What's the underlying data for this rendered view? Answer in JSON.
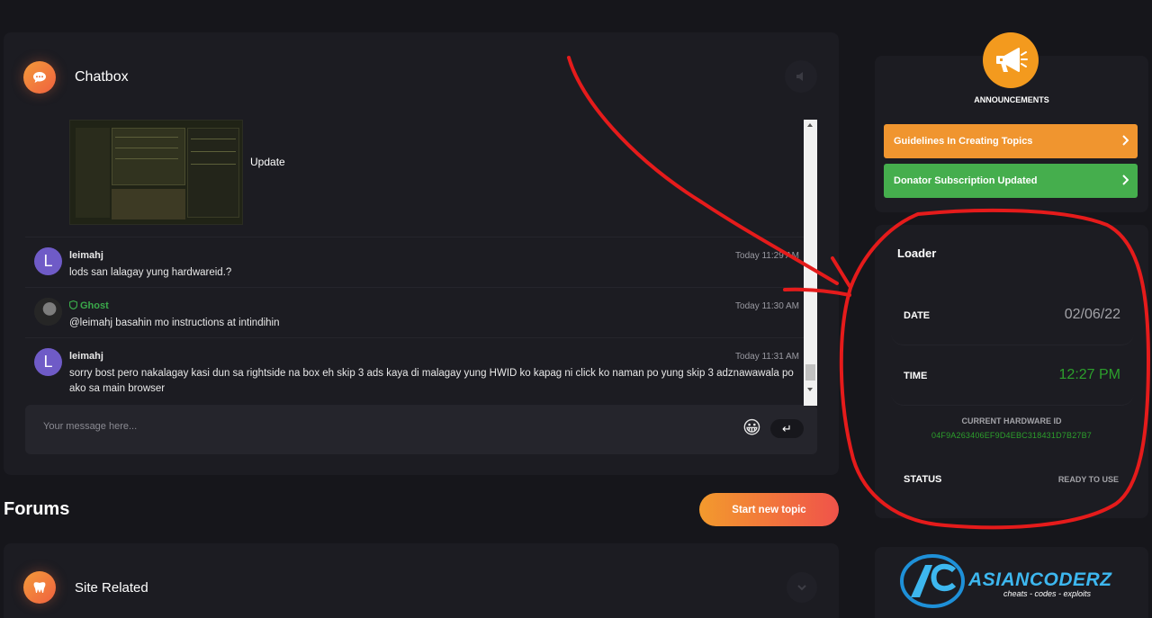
{
  "chatbox": {
    "title": "Chatbox",
    "image_caption": "Update",
    "messages": [
      {
        "avatar_letter": "L",
        "user": "leimahj",
        "time": "Today 11:29 AM",
        "text": "lods san lalagay yung hardwareid.?"
      },
      {
        "avatar_letter": "",
        "user": "Ghost",
        "time": "Today 11:30 AM",
        "text": "@leimahj basahin mo instructions at intindihin"
      },
      {
        "avatar_letter": "L",
        "user": "leimahj",
        "time": "Today 11:31 AM",
        "text": "sorry bost pero nakalagay kasi dun sa rightside na box eh skip 3 ads kaya di malagay yung HWID ko kapag ni click ko naman po yung skip 3 adznawawala po ako sa main browser"
      }
    ],
    "input_placeholder": "Your message here...",
    "emoji": "😀",
    "send_glyph": "↵"
  },
  "forums": {
    "title": "Forums",
    "new_topic_label": "Start new topic",
    "categories": [
      {
        "title": "Site Related"
      }
    ]
  },
  "announcements": {
    "label": "ANNOUNCEMENTS",
    "items": [
      {
        "label": "Guidelines In Creating Topics",
        "color": "#f0952f"
      },
      {
        "label": "Donator Subscription Updated",
        "color": "#45ae4d"
      }
    ]
  },
  "loader": {
    "title": "Loader",
    "date_label": "DATE",
    "date_value": "02/06/22",
    "time_label": "TIME",
    "time_value": "12:27 PM",
    "hwid_label": "CURRENT HARDWARE ID",
    "hwid_value": "04F9A263406EF9D4EBC318431D7B27B7",
    "status_label": "STATUS",
    "status_value": "READY TO USE"
  },
  "logo": {
    "name": "ASIANCODERZ",
    "tagline": "cheats - codes - exploits"
  },
  "colors": {
    "accent_orange": "#f39a1e",
    "accent_green": "#45ae4d",
    "annotation_red": "#e51b1b",
    "background": "#16161b"
  }
}
